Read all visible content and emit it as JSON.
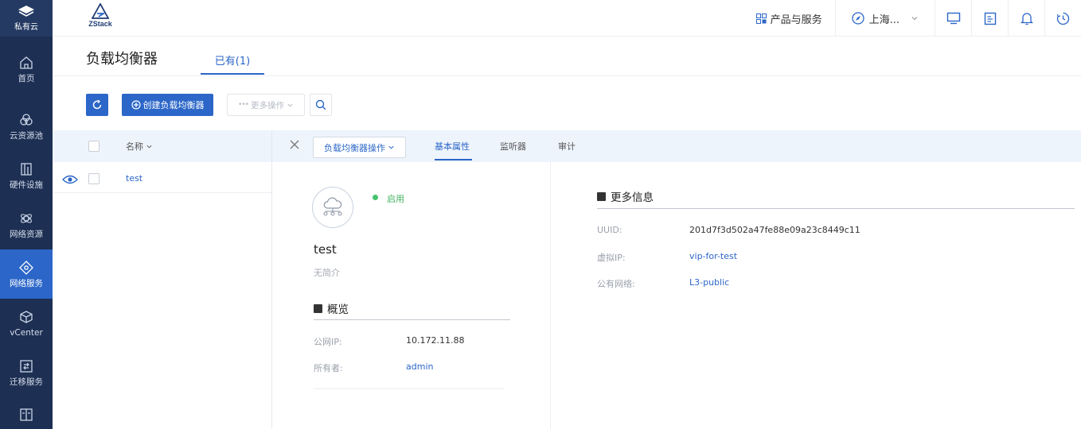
{
  "nav": {
    "brand_label": "私有云",
    "items": [
      {
        "label": "首页",
        "icon": "home-icon"
      },
      {
        "label": "云资源池",
        "icon": "resource-pool-icon"
      },
      {
        "label": "硬件设施",
        "icon": "hardware-icon"
      },
      {
        "label": "网络资源",
        "icon": "network-resource-icon"
      },
      {
        "label": "网络服务",
        "icon": "network-service-icon",
        "active": true
      },
      {
        "label": "vCenter",
        "icon": "cube-icon"
      },
      {
        "label": "迁移服务",
        "icon": "migration-icon"
      },
      {
        "label": "",
        "icon": "more-icon"
      }
    ]
  },
  "header": {
    "logo_text": "ZStack",
    "products": "产品与服务",
    "region": "上海...",
    "icons": [
      "monitor-icon",
      "document-icon",
      "bell-icon",
      "clock-icon"
    ]
  },
  "page": {
    "title": "负载均衡器",
    "tab_existing": "已有(1)"
  },
  "toolbar": {
    "create_label": "创建负载均衡器",
    "more_label": "更多操作"
  },
  "list": {
    "column_name": "名称",
    "rows": [
      {
        "name": "test"
      }
    ]
  },
  "detail": {
    "ops_label": "负载均衡器操作",
    "tabs": [
      "基本属性",
      "监听器",
      "审计"
    ],
    "status": "启用",
    "name": "test",
    "description": "无简介",
    "overview": {
      "title": "概览",
      "public_ip_label": "公网IP:",
      "public_ip": "10.172.11.88",
      "owner_label": "所有者:",
      "owner": "admin"
    },
    "more_info": {
      "title": "更多信息",
      "uuid_label": "UUID:",
      "uuid": "201d7f3d502a47fe88e09a23c8449c11",
      "vip_label": "虚拟IP:",
      "vip": "vip-for-test",
      "network_label": "公有网络:",
      "network": "L3-public"
    }
  },
  "colors": {
    "nav_bg": "#1d2f52",
    "accent": "#2b66c8",
    "status_green": "#45c36b"
  }
}
